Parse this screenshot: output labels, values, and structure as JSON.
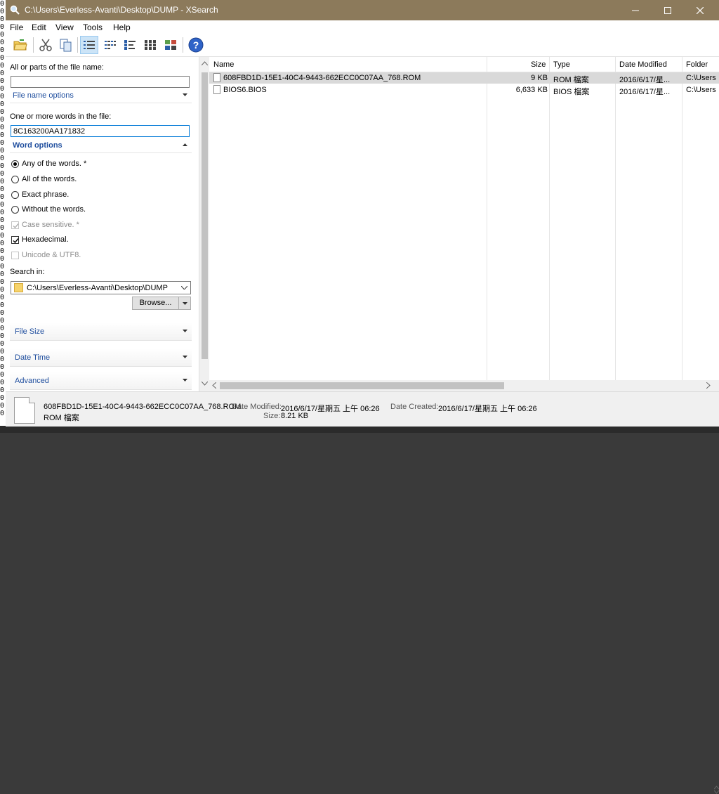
{
  "window": {
    "title": "C:\\Users\\Everless-Avanti\\Desktop\\DUMP - XSearch"
  },
  "backdrop_glyphs": [
    "0",
    "0",
    "0",
    "0",
    "0",
    "0",
    "0",
    "0",
    "0",
    "0",
    "0",
    "0",
    "0",
    "0",
    "0",
    "0",
    "0",
    "0",
    "0",
    "0",
    "0",
    "0",
    "0",
    "0",
    "0",
    "0",
    "0",
    "0",
    "0",
    "0",
    "0",
    "0",
    "0",
    "0",
    "0",
    "0",
    "0",
    "0",
    "0",
    "0",
    "0",
    "0",
    "0",
    "0",
    "0",
    "0",
    "0",
    "0",
    "0",
    "0",
    "0",
    "0",
    "0",
    "0"
  ],
  "menu": {
    "file": "File",
    "edit": "Edit",
    "view": "View",
    "tools": "Tools",
    "help": "Help"
  },
  "toolbar": {
    "icons": [
      "open-folder-icon",
      "cut-icon",
      "copy-icon",
      "details-view-icon",
      "list-view-icon",
      "small-icons-view-icon",
      "large-icons-view-icon",
      "tiles-view-icon",
      "help-icon"
    ],
    "active_view": "details-view-icon"
  },
  "search": {
    "filename_label": "All or parts of the file name:",
    "filename_value": "",
    "filename_options": "File name options",
    "words_label": "One or more words in the file:",
    "words_value": "8C163200AA171832",
    "word_options": "Word options",
    "radios": [
      "Any of the words. *",
      "All of the words.",
      "Exact phrase.",
      "Without the words."
    ],
    "selected_radio": "Any of the words. *",
    "checks": {
      "case_sensitive": "Case sensitive. *",
      "hexadecimal": "Hexadecimal.",
      "unicode": "Unicode & UTF8."
    },
    "case_sensitive_checked": true,
    "hexadecimal_checked": true,
    "unicode_checked": false,
    "search_in_label": "Search in:",
    "search_in_value": "C:\\Users\\Everless-Avanti\\Desktop\\DUMP",
    "browse_label": "Browse...",
    "file_size": "File Size",
    "date_time": "Date Time",
    "advanced": "Advanced"
  },
  "results": {
    "columns": [
      "Name",
      "Size",
      "Type",
      "Date Modified",
      "Folder"
    ],
    "rows": [
      {
        "name": "608FBD1D-15E1-40C4-9443-662ECC0C07AA_768.ROM",
        "size": "9 KB",
        "type": "ROM 檔案",
        "date": "2016/6/17/星...",
        "folder": "C:\\Users"
      },
      {
        "name": "BIOS6.BIOS",
        "size": "6,633 KB",
        "type": "BIOS 檔案",
        "date": "2016/6/17/星...",
        "folder": "C:\\Users"
      }
    ],
    "selected_row": 0
  },
  "status": {
    "file_name": "608FBD1D-15E1-40C4-9443-662ECC0C07AA_768.ROM",
    "file_type": "ROM 檔案",
    "date_modified_label": "Date Modified:",
    "date_modified_value": "2016/6/17/星期五 上午 06:26",
    "date_created_label": "Date Created:",
    "date_created_value": "2016/6/17/星期五 上午 06:26",
    "size_label": "Size:",
    "size_value": "8.21 KB"
  },
  "colors": {
    "titlebar": "#8c7a5b",
    "section_title": "#1f4e9e",
    "selection": "#d9d9d9",
    "focus_border": "#0078d7"
  }
}
